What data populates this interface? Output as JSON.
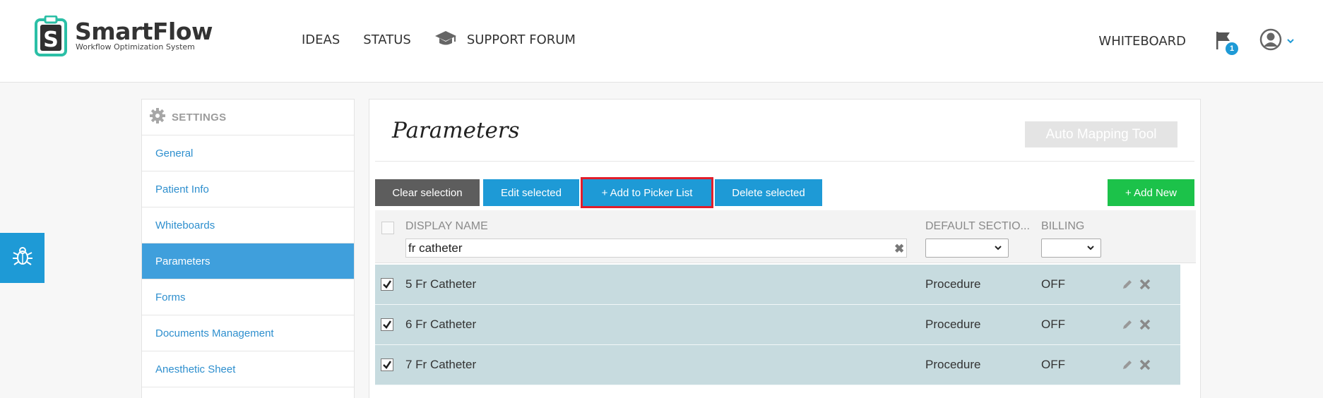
{
  "app": {
    "name": "SmartFlow",
    "tagline": "Workflow Optimization System",
    "logo_letter": "S"
  },
  "nav": {
    "ideas": "IDEAS",
    "status": "STATUS",
    "support_forum": "SUPPORT FORUM",
    "whiteboard": "WHITEBOARD",
    "notification_count": "1"
  },
  "sidebar": {
    "header": "SETTINGS",
    "items": [
      {
        "label": "General"
      },
      {
        "label": "Patient Info"
      },
      {
        "label": "Whiteboards"
      },
      {
        "label": "Parameters"
      },
      {
        "label": "Forms"
      },
      {
        "label": "Documents Management"
      },
      {
        "label": "Anesthetic Sheet"
      }
    ],
    "active": "Parameters"
  },
  "main": {
    "title": "Parameters",
    "auto_mapping_label": "Auto Mapping Tool",
    "toolbar": {
      "clear": "Clear selection",
      "edit": "Edit selected",
      "add_picker": "+ Add to Picker List",
      "delete": "Delete selected",
      "add_new": "+ Add New"
    },
    "grid": {
      "col_display_name": "DISPLAY NAME",
      "col_default_section": "DEFAULT SECTIO...",
      "col_billing": "BILLING",
      "filter_value": "fr catheter",
      "rows": [
        {
          "name": "5 Fr Catheter",
          "section": "Procedure",
          "billing": "OFF",
          "checked": true
        },
        {
          "name": "6 Fr Catheter",
          "section": "Procedure",
          "billing": "OFF",
          "checked": true
        },
        {
          "name": "7 Fr Catheter",
          "section": "Procedure",
          "billing": "OFF",
          "checked": true
        }
      ]
    }
  },
  "colors": {
    "accent": "#1e9ad6",
    "add_new": "#1cc24a",
    "highlight": "#e11d2b",
    "row_selected": "#c7dbdf",
    "logo": "#2bbfa6"
  }
}
